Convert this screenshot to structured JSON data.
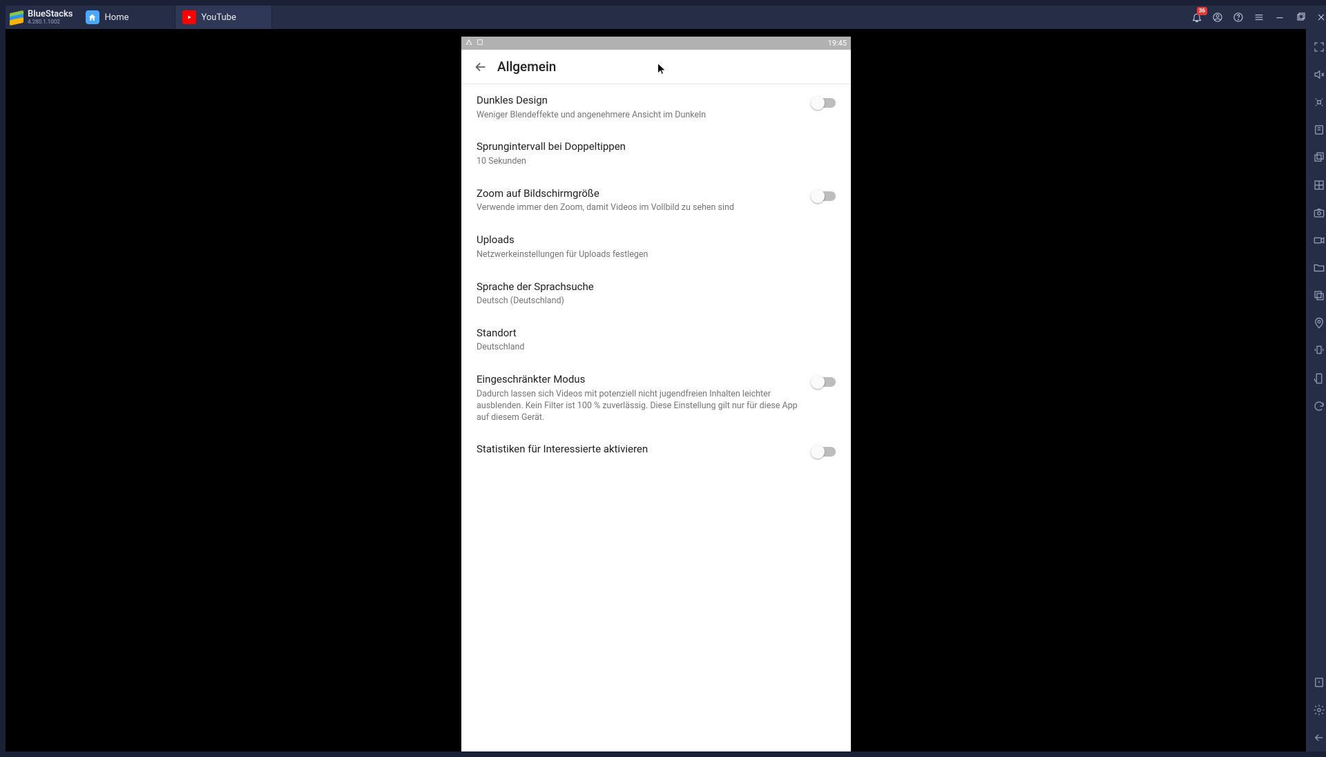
{
  "brand": {
    "name": "BlueStacks",
    "version": "4.280.1.1002"
  },
  "tabs": {
    "home": "Home",
    "youtube": "YouTube"
  },
  "notif_count": "36",
  "statusbar_time": "19:45",
  "app_header": {
    "title": "Allgemein"
  },
  "settings": {
    "dark": {
      "title": "Dunkles Design",
      "sub": "Weniger Blendeffekte und angenehmere Ansicht im Dunkeln"
    },
    "seek": {
      "title": "Sprungintervall bei Doppeltippen",
      "sub": "10 Sekunden"
    },
    "zoom": {
      "title": "Zoom auf Bildschirmgröße",
      "sub": "Verwende immer den Zoom, damit Videos im Vollbild zu sehen sind"
    },
    "uploads": {
      "title": "Uploads",
      "sub": "Netzwerkeinstellungen für Uploads festlegen"
    },
    "voice": {
      "title": "Sprache der Sprachsuche",
      "sub": "Deutsch (Deutschland)"
    },
    "loc": {
      "title": "Standort",
      "sub": "Deutschland"
    },
    "restr": {
      "title": "Eingeschränkter Modus",
      "sub": "Dadurch lassen sich Videos mit potenziell nicht jugendfreien Inhalten leichter ausblenden. Kein Filter ist 100 % zuverlässig. Diese Einstellung gilt nur für diese App auf diesem Gerät."
    },
    "stats": {
      "title": "Statistiken für Interessierte aktivieren"
    }
  }
}
